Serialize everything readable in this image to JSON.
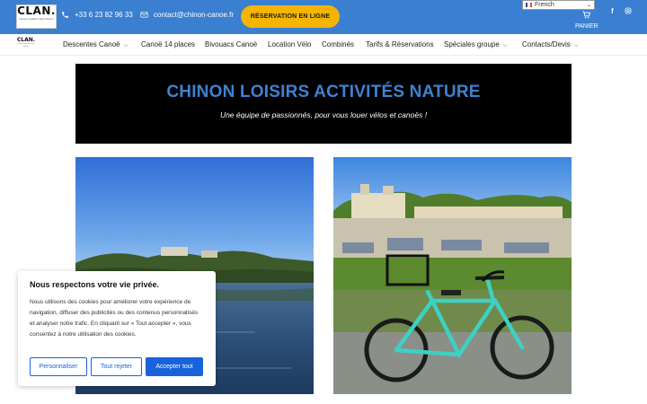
{
  "topbar": {
    "logo_title": "CLAN.",
    "logo_subtitle": "Canoë Location Vélo Chinon",
    "phone": "+33 6 23 82 96 33",
    "email": "contact@chinon-canoe.fr",
    "reservation_button": "RÉSERVATION EN LIGNE",
    "language": "French",
    "cart_label": "PANIER",
    "social": [
      "facebook-icon",
      "instagram-icon"
    ],
    "colors": {
      "bar": "#3a7fd0",
      "button": "#f5b400"
    }
  },
  "nav": {
    "logo_title": "CLAN.",
    "logo_subtitle": "Canoë Location Vélo Chinon",
    "items": [
      {
        "label": "Descentes Canoë",
        "dropdown": true
      },
      {
        "label": "Canoë 14 places",
        "dropdown": false
      },
      {
        "label": "Bivouacs Canoë",
        "dropdown": false
      },
      {
        "label": "Location Vélo",
        "dropdown": false
      },
      {
        "label": "Combinés",
        "dropdown": false
      },
      {
        "label": "Tarifs & Réservations",
        "dropdown": false
      },
      {
        "label": "Spéciales groupe",
        "dropdown": true
      },
      {
        "label": "Contacts/Devis",
        "dropdown": true
      }
    ]
  },
  "hero": {
    "title": "CHINON LOISIRS ACTIVITÉS NATURE",
    "subtitle": "Une équipe de passionnés, pour vous louer vélos et canoës !",
    "title_color": "#3f82d1"
  },
  "cookie": {
    "title": "Nous respectons votre vie privée.",
    "text": "Nous utilisons des cookies pour améliorer votre expérience de navigation, diffuser des publicités ou des contenus personnalisés et analyser notre trafic. En cliquant sur « Tout accepter », vous consentez à notre utilisation des cookies.",
    "customize_label": "Personnaliser",
    "reject_label": "Tout rejeter",
    "accept_label": "Accepter tout",
    "accent": "#1863dc"
  }
}
